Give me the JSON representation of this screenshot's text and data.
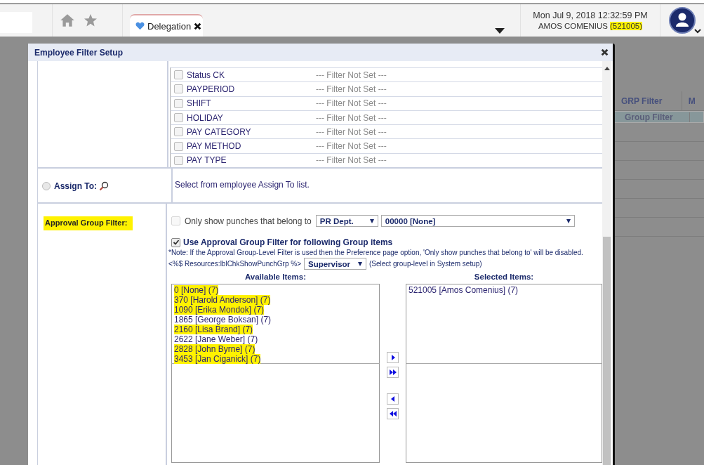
{
  "header": {
    "tabs": [
      {
        "label": "Delegation",
        "selected": true
      }
    ],
    "datetime": "Mon Jul 9, 2018 12:32:59 PM",
    "user_name": "AMOS COMENIUS",
    "user_id": "(521005)",
    "user_id_highlighted": true
  },
  "background_table": {
    "columns": [
      "GRP Filter",
      "M"
    ],
    "rows": [
      {
        "grp_filter": "Group Filter",
        "selected": true
      }
    ]
  },
  "dialog": {
    "title": "Employee Filter Setup",
    "filters": [
      {
        "label": "Status CK",
        "value": "--- Filter Not Set ---",
        "checked": false
      },
      {
        "label": "PAYPERIOD",
        "value": "--- Filter Not Set ---",
        "checked": false
      },
      {
        "label": "SHIFT",
        "value": "--- Filter Not Set ---",
        "checked": false
      },
      {
        "label": "HOLIDAY",
        "value": "--- Filter Not Set ---",
        "checked": false
      },
      {
        "label": "PAY CATEGORY",
        "value": "--- Filter Not Set ---",
        "checked": false
      },
      {
        "label": "PAY METHOD",
        "value": "--- Filter Not Set ---",
        "checked": false
      },
      {
        "label": "PAY TYPE",
        "value": "--- Filter Not Set ---",
        "checked": false
      }
    ],
    "assign_to": {
      "label": "Assign To:",
      "selected": false,
      "description": "Select from employee Assign To list."
    },
    "approval": {
      "label": "Approval Group Filter:",
      "highlighted": true,
      "only_show": {
        "label": "Only show punches that belong to",
        "checked": false,
        "disabled": true,
        "dept": "PR Dept.",
        "group": "00000 [None]"
      },
      "use_filter": {
        "label": "Use Approval Group Filter for following Group items",
        "checked": true
      },
      "note": "*Note: If the Approval Group-Level Filter is used then the Preference page option, 'Only show punches that belong to' will be disabled.",
      "resource_label": "<%$ Resources:lblChkShowPunchGrp %>",
      "level": "Supervisor",
      "level_hint": "(Select group-level in System setup)",
      "available_title": "Available Items:",
      "selected_title": "Selected Items:",
      "available_items": [
        {
          "text": "0 [None] (7)",
          "highlighted": true
        },
        {
          "text": "370 [Harold Anderson] (7)",
          "highlighted": true
        },
        {
          "text": "1090 [Erika Mondok] (7)",
          "highlighted": true
        },
        {
          "text": "1865 [George Boksan] (7)",
          "highlighted": false
        },
        {
          "text": "2160 [Lisa Brand] (7)",
          "highlighted": true
        },
        {
          "text": "2622 [Jane Weber] (7)",
          "highlighted": false
        },
        {
          "text": "2828 [John Byrne] (7)",
          "highlighted": true
        },
        {
          "text": "3453 [Jan Ciganick] (7)",
          "highlighted": true
        }
      ],
      "selected_items": [
        {
          "text": "521005 [Amos Comenius] (7)",
          "highlighted": false
        }
      ]
    }
  }
}
